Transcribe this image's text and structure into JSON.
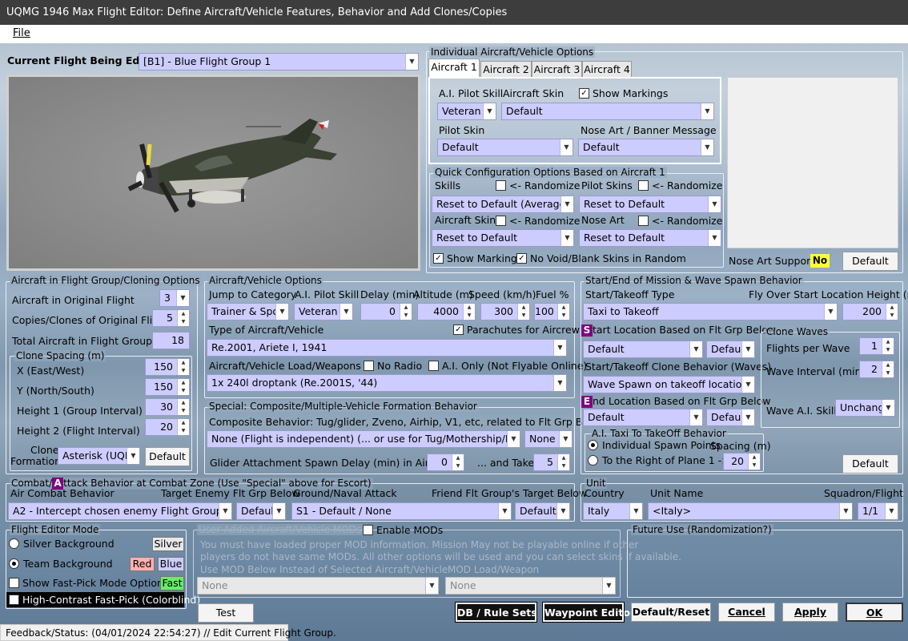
{
  "window": {
    "title": "UQMG 1946 Max Flight Editor:  Define Aircraft/Vehicle Features, Behavior and Add Clones/Copies"
  },
  "menu": {
    "file": "File"
  },
  "current": {
    "label": "Current Flight Being Edited:",
    "value": "[B1] - Blue Flight Group  1"
  },
  "individual": {
    "title": "Individual Aircraft/Vehicle Options",
    "tabs": [
      "Aircraft 1",
      "Aircraft 2",
      "Aircraft 3",
      "Aircraft 4"
    ],
    "ai_skill_label": "A.I. Pilot Skill",
    "ai_skill_value": "Veteran",
    "skin_label": "Aircraft Skin",
    "skin_value": "Default",
    "show_markings": "Show Markings",
    "pilot_skin_label": "Pilot Skin",
    "pilot_skin_value": "Default",
    "noseart_label": "Nose Art / Banner Message",
    "noseart_value": "Default"
  },
  "quick": {
    "title": "Quick Configuration Options Based on Aircraft 1",
    "skills": "Skills",
    "randomize": "<- Randomize",
    "pilot_skins": "Pilot Skins",
    "skills_value": "Reset to Default (Average)",
    "pilot_skins_value": "Reset to Default",
    "aircraft_skins": "Aircraft Skins",
    "nose_art": "Nose Art",
    "aircraft_skins_value": "Reset to Default",
    "nose_art_value": "Reset to Default",
    "show_markings": "Show Markings",
    "no_void": "No Void/Blank Skins in Random"
  },
  "noseart_support": {
    "label": "Nose Art Support:",
    "value": "No",
    "default_btn": "Default"
  },
  "cloning": {
    "title": "Aircraft in Flight Group/Cloning Options",
    "orig_label": "Aircraft in Original Flight",
    "orig_value": "3",
    "copies_label": "Copies/Clones of Original Flight",
    "copies_value": "5",
    "total_label": "Total Aircraft in Flight Group",
    "total_value": "18",
    "spacing_title": "Clone Spacing (m)",
    "x_label": "X (East/West)",
    "x_value": "150",
    "y_label": "Y (North/South)",
    "y_value": "150",
    "h1_label": "Height 1 (Group Interval)",
    "h1_value": "30",
    "h2_label": "Height 2 (Flight Interval)",
    "h2_value": "20",
    "formation_label1": "Clone",
    "formation_label2": "Formation",
    "formation_value": "Asterisk (UQM",
    "default_btn": "Default"
  },
  "vehicle": {
    "title": "Aircraft/Vehicle Options",
    "jump_label": "Jump to Category",
    "jump_value": "Trainer & Spor",
    "ai_label": "A.I. Pilot Skill",
    "ai_value": "Veteran",
    "delay_label": "Delay (min)",
    "delay_value": "0",
    "alt_label": "Altitude (m)",
    "alt_value": "4000",
    "speed_label": "Speed (km/h)",
    "speed_value": "300",
    "fuel_label": "Fuel %",
    "fuel_value": "100",
    "type_label": "Type of Aircraft/Vehicle",
    "parachutes": "Parachutes for Aircrew",
    "type_value": "Re.2001, Ariete I, 1941",
    "load_label": "Aircraft/Vehicle Load/Weapons",
    "no_radio": "No Radio",
    "ai_only": "A.I. Only (Not Flyable Online)",
    "load_value": "1x 240l droptank (Re.2001S, '44)"
  },
  "special": {
    "title": "Special: Composite/Multiple-Vehicle Formation Behavior",
    "desc": "Composite Behavior: Tug/glider, Zveno, Airhip, V1, etc, related to Flt Grp Below",
    "composite_value": "None (Flight is independent) (... or use for Tug/Mothership/Mistel Bo",
    "none_value": "None",
    "glider_label": "Glider Attachment Spawn Delay (min) in Air Start",
    "glider_value": "0",
    "takeoff_label": "... and Takeoff",
    "takeoff_value": "5"
  },
  "mission": {
    "title": "Start/End of Mission & Wave Spawn Behavior",
    "type_label": "Start/Takeoff Type",
    "flyover_label": "Fly Over Start Location Height (m)",
    "type_value": "Taxi to Takeoff",
    "flyover_value": "200",
    "start_badge": "S",
    "start_label": "tart Location Based on Flt Grp Below",
    "start_value": "Default",
    "start_value2": "Defaul",
    "clone_beh_label": "Start/Takeoff Clone Behavior (Waves)",
    "clone_beh_value": "Wave Spawn on takeoff location",
    "end_badge": "E",
    "end_label": "nd Location Based on Flt Grp Below",
    "end_value": "Default",
    "end_value2": "Defaul",
    "waves_title": "Clone Waves",
    "fpw_label": "Flights per Wave",
    "fpw_value": "1",
    "wi_label": "Wave Interval (min)",
    "wi_value": "2",
    "ws_label": "Wave A.I. Skills",
    "ws_value": "Unchange",
    "taxi_title": "A.I. Taxi To TakeOff Behavior",
    "individual": "Individual Spawn Points",
    "spacing": "Spacing (m)",
    "right": "To the Right of Plane 1 ->",
    "right_value": "20",
    "default_btn": "Default"
  },
  "combat": {
    "badge": "A",
    "title_pre": "Combat/",
    "title": "ttack Behavior at Combat Zone (Use \"Special\" above for Escort)",
    "air_label": "Air Combat Behavior",
    "target_label": "Target Enemy Flt Grp Below",
    "ground_label": "Ground/Naval Attack",
    "friend_label": "Friend Flt Group's Target Below",
    "air_value": "A2 - Intercept chosen enemy Flight Group",
    "target_value": "Defaul",
    "ground_value": "S1 - Default / None",
    "friend_value": "Default"
  },
  "unit": {
    "title": "Unit",
    "country_label": "Country",
    "name_label": "Unit Name",
    "squadron_label": "Squadron/Flight",
    "country_value": "Italy",
    "name_value": "<Italy>",
    "squadron_value": "1/1"
  },
  "mode": {
    "title": "Flight Editor Mode",
    "silver_bg": "Silver Background",
    "silver": "Silver",
    "team_bg": "Team Background",
    "red": "Red",
    "blue": "Blue",
    "fastpick": "Show Fast-Pick Mode Options",
    "fast": "Fast",
    "contrast": "High-Contrast Fast-Pick (Colorblind)"
  },
  "mods": {
    "title": "User Added Aircraft/Vehicle MODs",
    "enable": "Enable MODs",
    "warn1": "You must have loaded proper MOD information.  Mission May not be playable online if other",
    "warn2": "players do not have same MODs.  All other options will be used and you can select skins if available.",
    "use_label": "Use MOD Below Instead of Selected Aircraft/Vehicle",
    "load_label": "MOD Load/Weapon",
    "mod_value": "None",
    "load_value": "None"
  },
  "future": {
    "title": "Future Use (Randomization?)"
  },
  "buttons": {
    "test": "Test",
    "db": "DB / Rule Sets",
    "waypoint": "Waypoint Editor",
    "reset": "Default/Reset",
    "cancel": "Cancel",
    "apply": "Apply",
    "ok": "OK"
  },
  "status": {
    "text": "Feedback/Status:  (04/01/2024 22:54:27) // Edit Current Flight Group."
  },
  "colors": {
    "select_bg": "#ccccff",
    "badge": "#800080",
    "red": "#ffb0b0",
    "blue": "#ccccff",
    "silver": "#e8e8e8",
    "fast": "#66ee66",
    "noseart_no": "#ffff33"
  }
}
